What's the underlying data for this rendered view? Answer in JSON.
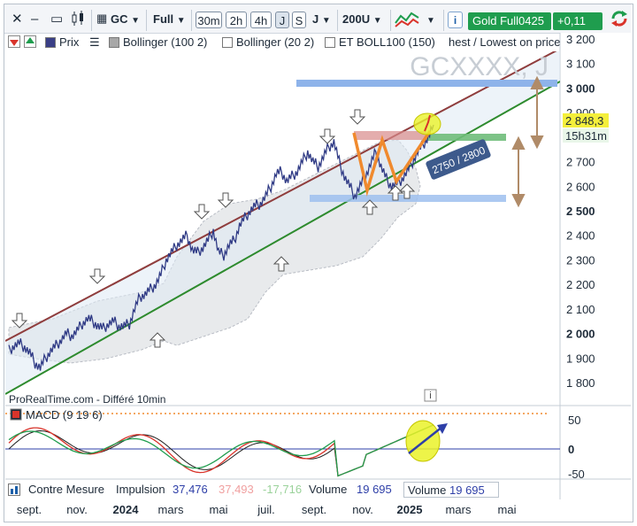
{
  "toolbar": {
    "close": "✕",
    "minimize": "–",
    "restore": "▭",
    "instrument": "GC",
    "view": "Full",
    "timeframes": [
      "30m",
      "2h",
      "4h",
      "J",
      "S"
    ],
    "timeframe_selected": "J",
    "period": "J",
    "units": "200U",
    "info": "i",
    "symbol_badge": "Gold Full0425",
    "change_badge": "+0,11 %",
    "colors": {
      "symbol_badge": "#1f9d4e",
      "change_badge": "#1f9d4e"
    }
  },
  "legend": {
    "price": "Prix",
    "boll1": "Bollinger (100 2)",
    "boll2": "Bollinger (20 2)",
    "boll3": "ET BOLL100 (150)",
    "extra": "hest / Lowest on price"
  },
  "watermark": "GCXXXX, J",
  "credit": "ProRealTime.com - Différé 10min",
  "zone_label": "2750 / 2800",
  "price_tag": "2 848,3",
  "time_tag": "15h31m",
  "macd": {
    "label": "MACD (9 19 6)",
    "ticks": [
      "50",
      "0",
      "-50"
    ]
  },
  "bottom": {
    "contre": "Contre Mesure",
    "impulsion": "Impulsion",
    "v1": "37,476",
    "v2": "37,493",
    "v3": "-17,716",
    "volume_label": "Volume",
    "volume_value": "19 695",
    "volume_label2": "Volume",
    "volume_value2": "19 695"
  },
  "chart_data": {
    "type": "line",
    "title": "GCXXXX, J",
    "y_ticks": [
      "3 200",
      "3 100",
      "3 000",
      "2 900",
      "2 800",
      "2 700",
      "2 600",
      "2 500",
      "2 400",
      "2 300",
      "2 200",
      "2 100",
      "2 000",
      "1 900",
      "1 800"
    ],
    "y_ticks_bold": [
      "3 000",
      "2 500",
      "2 000"
    ],
    "ylim": [
      1750,
      3230
    ],
    "x_ticks": [
      "sept.",
      "nov.",
      "2024",
      "mars",
      "mai",
      "juil.",
      "sept.",
      "nov.",
      "2025",
      "mars",
      "mai"
    ],
    "x_ticks_bold": [
      "2024",
      "2025"
    ],
    "last_price": 2848.3,
    "resistance_zone": [
      2750,
      2800
    ],
    "levels": {
      "upper_blue": 3000,
      "lower_blue": 2535,
      "green_band": 2770
    },
    "price_series": [
      1930,
      1950,
      1960,
      1945,
      1920,
      1880,
      1860,
      1900,
      1930,
      1950,
      1975,
      2000,
      1990,
      2010,
      2040,
      2060,
      2050,
      2030,
      2020,
      2040,
      2050,
      2030,
      2030,
      2040,
      2100,
      2150,
      2160,
      2180,
      2200,
      2240,
      2300,
      2330,
      2360,
      2380,
      2400,
      2340,
      2330,
      2350,
      2380,
      2420,
      2330,
      2320,
      2360,
      2380,
      2440,
      2470,
      2500,
      2520,
      2530,
      2560,
      2600,
      2650,
      2660,
      2620,
      2640,
      2660,
      2700,
      2740,
      2700,
      2680,
      2720,
      2760,
      2780,
      2700,
      2640,
      2600,
      2560,
      2600,
      2640,
      2690,
      2740,
      2680,
      2630,
      2600,
      2610,
      2630,
      2660,
      2700,
      2740,
      2770,
      2800,
      2850
    ]
  }
}
